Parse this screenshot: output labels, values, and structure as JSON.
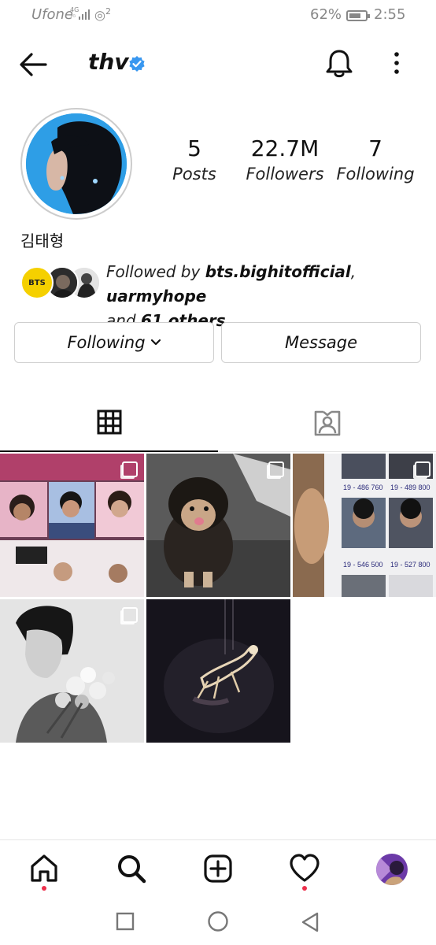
{
  "status_bar": {
    "carrier": "Ufone",
    "network_top": "4G",
    "network_bottom": "¹ᴳ",
    "hotspot_count": "2",
    "battery_pct": "62%",
    "time": "2:55"
  },
  "header": {
    "username": "thv",
    "verified": true,
    "icons": [
      "back-arrow-icon",
      "verified-badge-icon",
      "bell-icon",
      "more-icon"
    ]
  },
  "profile": {
    "full_name": "김태형",
    "stats": [
      {
        "value": "5",
        "label": "Posts"
      },
      {
        "value": "22.7M",
        "label": "Followers"
      },
      {
        "value": "7",
        "label": "Following"
      }
    ],
    "followed_by_prefix": "Followed by ",
    "followed_by_user1": "bts.bighitofficial",
    "followed_by_sep": ", ",
    "followed_by_user2": "uarmyhope",
    "followed_by_and": "and ",
    "followed_by_others": "61 others",
    "bts_badge": "BTS"
  },
  "buttons": {
    "following_label": "Following",
    "message_label": "Message"
  },
  "tabs": [
    "grid-icon",
    "tagged-icon"
  ],
  "posts": [
    {
      "name": "post-1",
      "multi": true
    },
    {
      "name": "post-2",
      "multi": true
    },
    {
      "name": "post-3",
      "multi": true
    },
    {
      "name": "post-4",
      "multi": true
    },
    {
      "name": "post-5",
      "multi": false
    }
  ],
  "bottom_nav": [
    "home-icon",
    "search-icon",
    "new-post-icon",
    "activity-icon",
    "profile-avatar"
  ],
  "colors": {
    "verified_blue": "#3897f0",
    "notification_dot": "#ed2f4b",
    "bts_yellow": "#f5d000"
  }
}
